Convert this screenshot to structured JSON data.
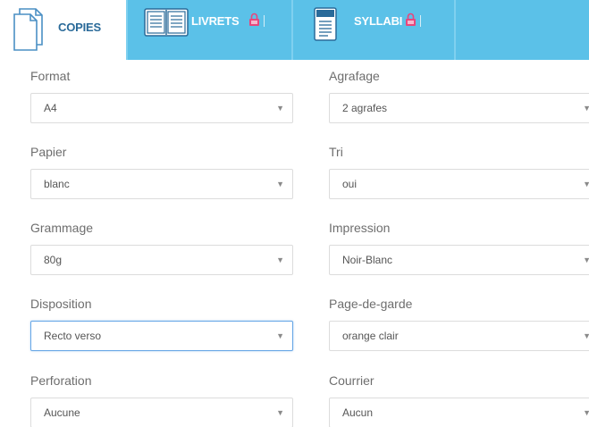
{
  "tabs": {
    "copies": {
      "label": "COPIES"
    },
    "livrets": {
      "label": "LIVRETS"
    },
    "syllabi": {
      "label": "SYLLABI"
    }
  },
  "colors": {
    "tab_bar": "#5bc1e8",
    "active_tab_text": "#2a6a99",
    "lock": "#e8467c",
    "focus_border": "#66a6e6"
  },
  "form": {
    "format": {
      "label": "Format",
      "value": "A4"
    },
    "agrafage": {
      "label": "Agrafage",
      "value": "2 agrafes"
    },
    "papier": {
      "label": "Papier",
      "value": "blanc"
    },
    "tri": {
      "label": "Tri",
      "value": "oui"
    },
    "grammage": {
      "label": "Grammage",
      "value": "80g"
    },
    "impression": {
      "label": "Impression",
      "value": "Noir-Blanc"
    },
    "disposition": {
      "label": "Disposition",
      "value": "Recto verso"
    },
    "page_de_garde": {
      "label": "Page-de-garde",
      "value": "orange clair"
    },
    "perforation": {
      "label": "Perforation",
      "value": "Aucune"
    },
    "courrier": {
      "label": "Courrier",
      "value": "Aucun"
    }
  },
  "icons": {
    "copies": "document-icon",
    "livrets": "open-book-icon",
    "syllabi": "notebook-icon",
    "lock": "lock-icon",
    "arrow": "dropdown-arrow-icon"
  },
  "glyphs": {
    "arrow": "▼"
  }
}
